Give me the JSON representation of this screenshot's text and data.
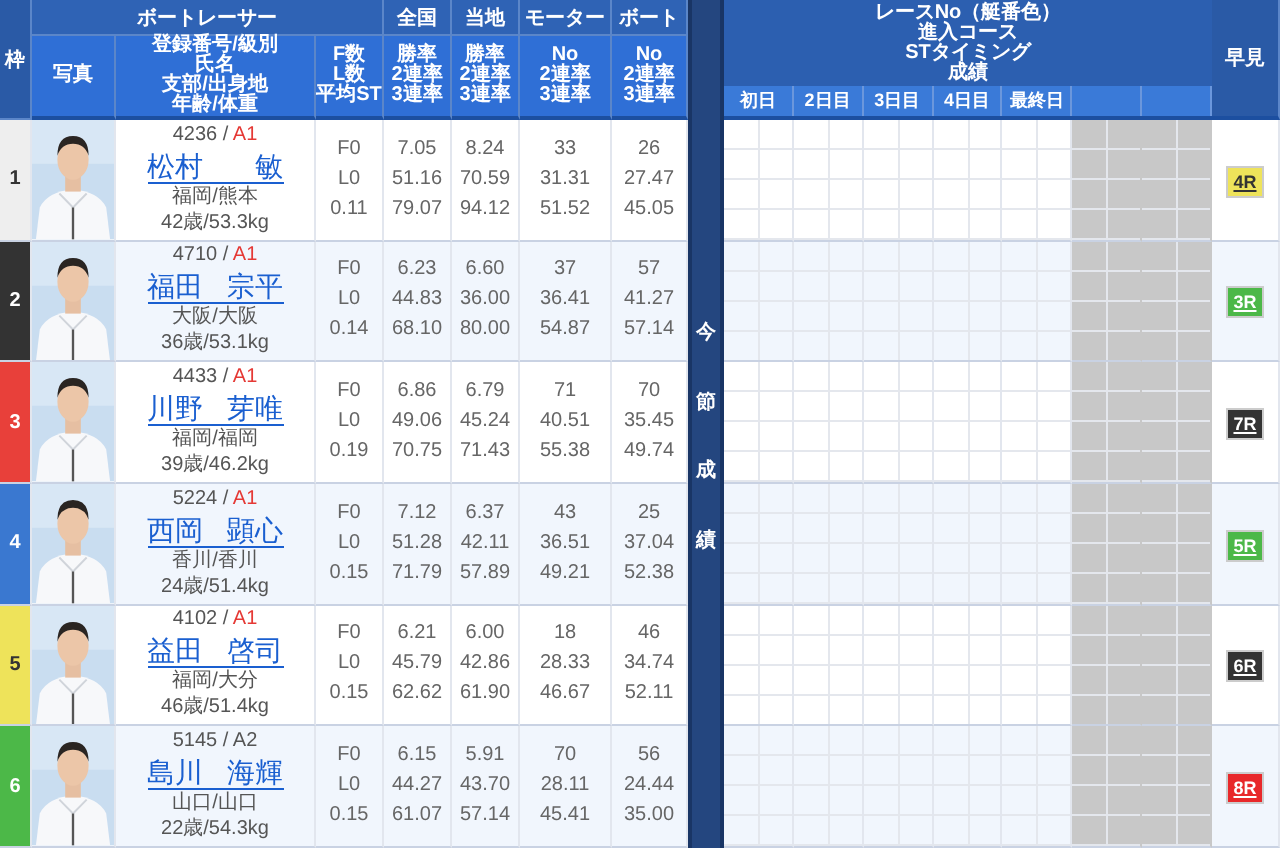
{
  "header": {
    "frame": "枠",
    "racer_group": "ボートレーサー",
    "photo": "写真",
    "info": [
      "登録番号/級別",
      "氏名",
      "支部/出身地",
      "年齢/体重"
    ],
    "fl": [
      "F数",
      "L数",
      "平均ST"
    ],
    "stat_groups": [
      {
        "title": "全国",
        "lines": [
          "勝率",
          "2連率",
          "3連率"
        ]
      },
      {
        "title": "当地",
        "lines": [
          "勝率",
          "2連率",
          "3連率"
        ]
      },
      {
        "title": "モーター",
        "lines": [
          "No",
          "2連率",
          "3連率"
        ]
      },
      {
        "title": "ボート",
        "lines": [
          "No",
          "2連率",
          "3連率"
        ]
      }
    ],
    "results_title": [
      "レースNo（艇番色）",
      "進入コース",
      "STタイミング",
      "成績"
    ],
    "days": [
      "初日",
      "2日目",
      "3日目",
      "4日目",
      "最終日"
    ],
    "quick": "早見"
  },
  "band_label": "今節成績",
  "racers": [
    {
      "frame": {
        "number": "1",
        "color": "#eeeeee"
      },
      "photo": {
        "kind": "picture"
      },
      "registration": "4236 /",
      "class": {
        "text": "A1",
        "color": "#e53935"
      },
      "surname": "松村",
      "given_name": "敏",
      "origin": "福岡/熊本",
      "age_weight": "42歳/53.3kg",
      "fl": [
        "F0",
        "L0",
        "0.11"
      ],
      "national": [
        "7.05",
        "51.16",
        "79.07"
      ],
      "local": [
        "8.24",
        "70.59",
        "94.12"
      ],
      "motor": [
        "33",
        "31.31",
        "51.52"
      ],
      "boat": [
        "26",
        "27.47",
        "45.05"
      ],
      "quick": {
        "label": "4R",
        "color": "#eee35a"
      }
    },
    {
      "frame": {
        "number": "2",
        "color": "#333333"
      },
      "photo": {
        "kind": "picture"
      },
      "registration": "4710 /",
      "class": {
        "text": "A1",
        "color": "#e53935"
      },
      "surname": "福田",
      "given_name": "宗平",
      "origin": "大阪/大阪",
      "age_weight": "36歳/53.1kg",
      "fl": [
        "F0",
        "L0",
        "0.14"
      ],
      "national": [
        "6.23",
        "44.83",
        "68.10"
      ],
      "local": [
        "6.60",
        "36.00",
        "80.00"
      ],
      "motor": [
        "37",
        "36.41",
        "54.87"
      ],
      "boat": [
        "57",
        "41.27",
        "57.14"
      ],
      "quick": {
        "label": "3R",
        "color": "#4cb848"
      }
    },
    {
      "frame": {
        "number": "3",
        "color": "#e8403a"
      },
      "photo": {
        "kind": "picture"
      },
      "registration": "4433 /",
      "class": {
        "text": "A1",
        "color": "#e53935"
      },
      "surname": "川野",
      "given_name": "芽唯",
      "origin": "福岡/福岡",
      "age_weight": "39歳/46.2kg",
      "fl": [
        "F0",
        "L0",
        "0.19"
      ],
      "national": [
        "6.86",
        "49.06",
        "70.75"
      ],
      "local": [
        "6.79",
        "45.24",
        "71.43"
      ],
      "motor": [
        "71",
        "40.51",
        "55.38"
      ],
      "boat": [
        "70",
        "35.45",
        "49.74"
      ],
      "quick": {
        "label": "7R",
        "color": "#333333"
      }
    },
    {
      "frame": {
        "number": "4",
        "color": "#3a78d0"
      },
      "photo": {
        "kind": "picture"
      },
      "registration": "5224 /",
      "class": {
        "text": "A1",
        "color": "#e53935"
      },
      "surname": "西岡",
      "given_name": "顕心",
      "origin": "香川/香川",
      "age_weight": "24歳/51.4kg",
      "fl": [
        "F0",
        "L0",
        "0.15"
      ],
      "national": [
        "7.12",
        "51.28",
        "71.79"
      ],
      "local": [
        "6.37",
        "42.11",
        "57.89"
      ],
      "motor": [
        "43",
        "36.51",
        "49.21"
      ],
      "boat": [
        "25",
        "37.04",
        "52.38"
      ],
      "quick": {
        "label": "5R",
        "color": "#4cb848"
      }
    },
    {
      "frame": {
        "number": "5",
        "color": "#eee35a"
      },
      "photo": {
        "kind": "picture"
      },
      "registration": "4102 /",
      "class": {
        "text": "A1",
        "color": "#e53935"
      },
      "surname": "益田",
      "given_name": "啓司",
      "origin": "福岡/大分",
      "age_weight": "46歳/51.4kg",
      "fl": [
        "F0",
        "L0",
        "0.15"
      ],
      "national": [
        "6.21",
        "45.79",
        "62.62"
      ],
      "local": [
        "6.00",
        "42.86",
        "61.90"
      ],
      "motor": [
        "18",
        "28.33",
        "46.67"
      ],
      "boat": [
        "46",
        "34.74",
        "52.11"
      ],
      "quick": {
        "label": "6R",
        "color": "#333333"
      }
    },
    {
      "frame": {
        "number": "6",
        "color": "#4cb848"
      },
      "photo": {
        "kind": "picture"
      },
      "registration": "5145 /",
      "class": {
        "text": "A2",
        "color": "#555555"
      },
      "surname": "島川",
      "given_name": "海輝",
      "origin": "山口/山口",
      "age_weight": "22歳/54.3kg",
      "fl": [
        "F0",
        "L0",
        "0.15"
      ],
      "national": [
        "6.15",
        "44.27",
        "61.07"
      ],
      "local": [
        "5.91",
        "43.70",
        "57.14"
      ],
      "motor": [
        "70",
        "28.11",
        "45.41"
      ],
      "boat": [
        "56",
        "24.44",
        "35.00"
      ],
      "quick": {
        "label": "8R",
        "color": "#e8282a"
      }
    }
  ]
}
